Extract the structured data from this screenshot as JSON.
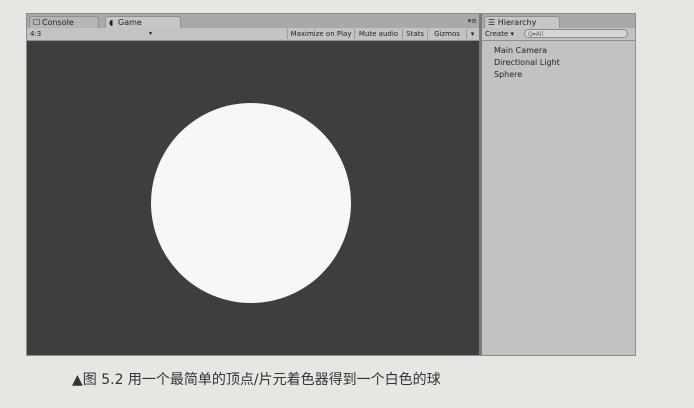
{
  "tabs": {
    "console": "Console",
    "game": "Game"
  },
  "toolbar": {
    "aspect": "4:3",
    "maximize_label": "Maximize on Play",
    "mute_label": "Mute audio",
    "stats_label": "Stats",
    "gizmos_label": "Gizmos"
  },
  "hierarchy": {
    "tab_label": "Hierarchy",
    "create_label": "Create",
    "search_placeholder": "Q▾All",
    "items": [
      "Main Camera",
      "Directional Light",
      "Sphere"
    ]
  },
  "colors": {
    "viewport_bg": "#3e3e3e",
    "sphere": "#f7f7f6"
  },
  "caption": "▲图 5.2   用一个最简单的顶点/片元着色器得到一个白色的球"
}
